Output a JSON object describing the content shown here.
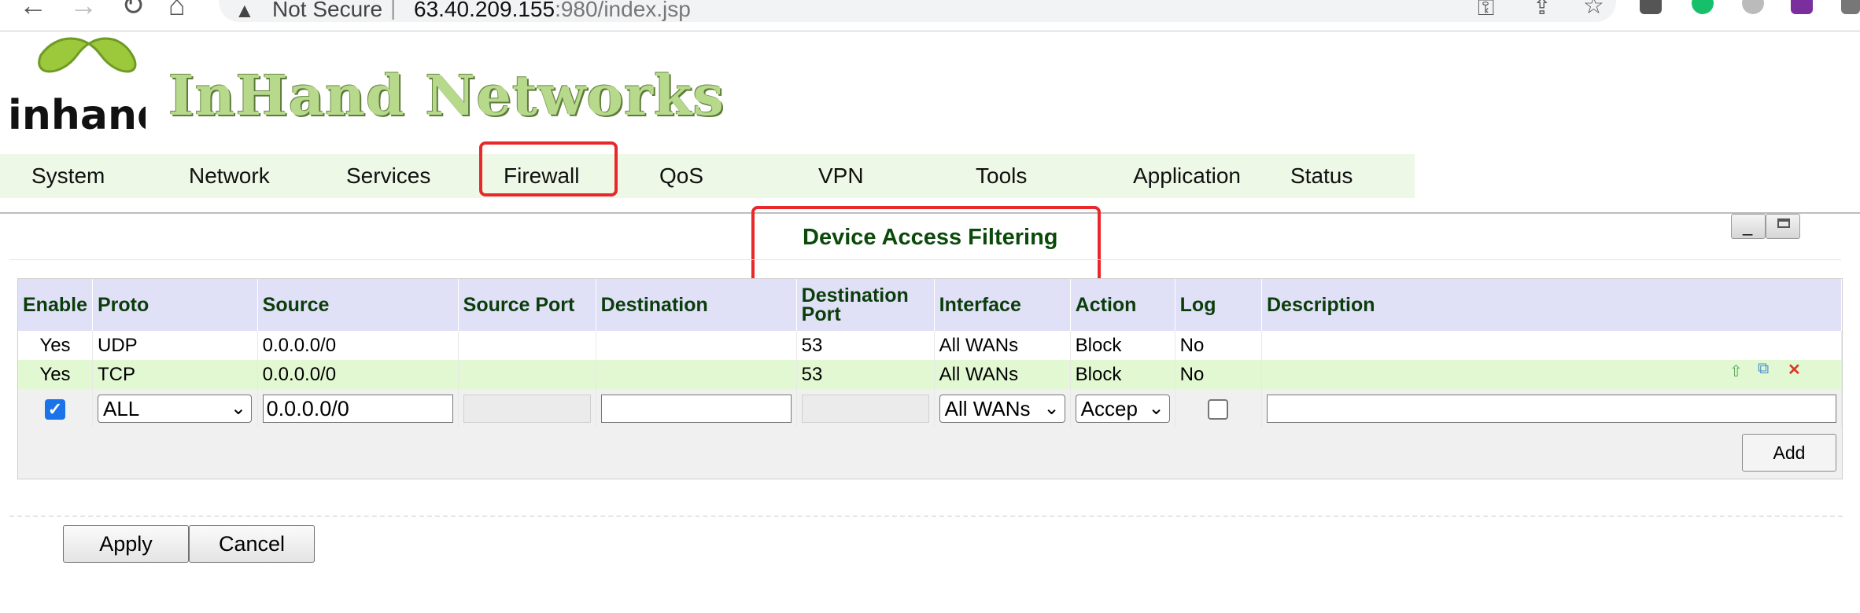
{
  "browser": {
    "security_label": "Not Secure",
    "separator": "|",
    "host": "63.40.209.155",
    "path": ":980/index.jsp"
  },
  "header": {
    "brand_logo_text": "inhand",
    "brand_title": "InHand Networks"
  },
  "menu": {
    "items": [
      {
        "label": "System"
      },
      {
        "label": "Network"
      },
      {
        "label": "Services"
      },
      {
        "label": "Firewall"
      },
      {
        "label": "QoS"
      },
      {
        "label": "VPN"
      },
      {
        "label": "Tools"
      },
      {
        "label": "Application"
      },
      {
        "label": "Status"
      }
    ]
  },
  "page": {
    "title": "Device Access Filtering"
  },
  "table": {
    "columns": {
      "enable": "Enable",
      "proto": "Proto",
      "source": "Source",
      "source_port": "Source Port",
      "destination": "Destination",
      "destination_port": "Destination Port",
      "interface": "Interface",
      "action": "Action",
      "log": "Log",
      "description": "Description"
    },
    "rows": [
      {
        "enable": "Yes",
        "proto": "UDP",
        "source": "0.0.0.0/0",
        "source_port": "",
        "destination": "",
        "destination_port": "53",
        "interface": "All WANs",
        "action": "Block",
        "log": "No",
        "description": ""
      },
      {
        "enable": "Yes",
        "proto": "TCP",
        "source": "0.0.0.0/0",
        "source_port": "",
        "destination": "",
        "destination_port": "53",
        "interface": "All WANs",
        "action": "Block",
        "log": "No",
        "description": ""
      }
    ],
    "new_rule": {
      "proto_selected": "ALL",
      "source_value": "0.0.0.0/0",
      "interface_selected": "All WANs",
      "action_selected": "Accep"
    },
    "add_label": "Add"
  },
  "buttons": {
    "apply_label": "Apply",
    "cancel_label": "Cancel"
  },
  "colors": {
    "highlight_box": "#e8282a",
    "menu_background": "#eef8e6",
    "header_background": "#e0e0f7",
    "title_color": "#0b4a0b"
  }
}
